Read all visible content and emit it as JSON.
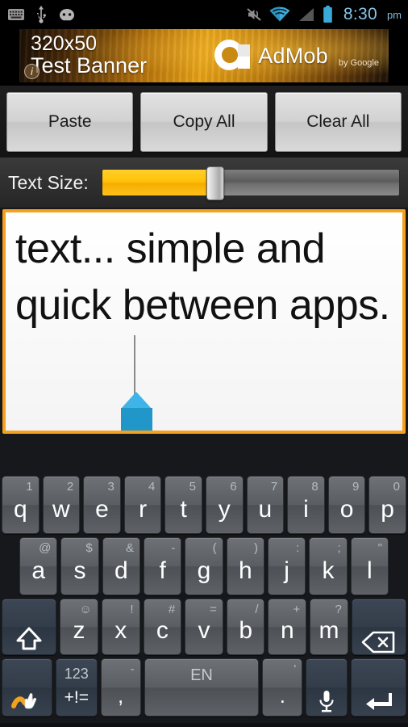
{
  "status_bar": {
    "left_icons": [
      {
        "name": "keyboard-icon",
        "label": "keyboard"
      },
      {
        "name": "usb-icon",
        "label": "usb"
      },
      {
        "name": "android-icon",
        "label": "android"
      }
    ],
    "right_icons": [
      {
        "name": "mute-icon",
        "label": "sound off"
      },
      {
        "name": "wifi-icon",
        "label": "wifi"
      },
      {
        "name": "signal-icon",
        "label": "signal"
      },
      {
        "name": "battery-icon",
        "label": "battery"
      }
    ],
    "time": "8:30",
    "ampm": "pm",
    "time_color": "#84c7e8"
  },
  "ad": {
    "line1": "320x50",
    "line2": "Test Banner",
    "brand": "AdMob",
    "brand_by": "by Google",
    "info_badge": "i"
  },
  "toolbar": {
    "paste_label": "Paste",
    "copy_all_label": "Copy All",
    "clear_all_label": "Clear All"
  },
  "text_size": {
    "label": "Text Size:",
    "value_percent": 38,
    "fill_color": "#ffc107"
  },
  "editor": {
    "content": "text... simple and quick between apps.",
    "border_color": "#f6a11d",
    "handle_color": "#2196c9"
  },
  "keyboard": {
    "row1": [
      {
        "main": "q",
        "hint": "1"
      },
      {
        "main": "w",
        "hint": "2"
      },
      {
        "main": "e",
        "hint": "3"
      },
      {
        "main": "r",
        "hint": "4"
      },
      {
        "main": "t",
        "hint": "5"
      },
      {
        "main": "y",
        "hint": "6"
      },
      {
        "main": "u",
        "hint": "7"
      },
      {
        "main": "i",
        "hint": "8"
      },
      {
        "main": "o",
        "hint": "9"
      },
      {
        "main": "p",
        "hint": "0"
      }
    ],
    "row2": [
      {
        "main": "a",
        "hint": "@"
      },
      {
        "main": "s",
        "hint": "$"
      },
      {
        "main": "d",
        "hint": "&"
      },
      {
        "main": "f",
        "hint": "-"
      },
      {
        "main": "g",
        "hint": "("
      },
      {
        "main": "h",
        "hint": ")"
      },
      {
        "main": "j",
        "hint": ":"
      },
      {
        "main": "k",
        "hint": ";"
      },
      {
        "main": "l",
        "hint": "\""
      }
    ],
    "row3": [
      {
        "main": "z",
        "hint": "☺"
      },
      {
        "main": "x",
        "hint": "!"
      },
      {
        "main": "c",
        "hint": "#"
      },
      {
        "main": "v",
        "hint": "="
      },
      {
        "main": "b",
        "hint": "/"
      },
      {
        "main": "n",
        "hint": "+"
      },
      {
        "main": "m",
        "hint": "?"
      }
    ],
    "shift_key": "shift",
    "backspace_key": "backspace",
    "gesture_key": "swipe-input",
    "num_key_main": "+!=",
    "num_key_hint": "123",
    "comma_key_main": ",",
    "comma_key_hint": "-",
    "space_key": "EN",
    "period_key_main": ".",
    "period_key_hint": "'",
    "mic_key": "voice-input",
    "enter_key": "enter"
  }
}
